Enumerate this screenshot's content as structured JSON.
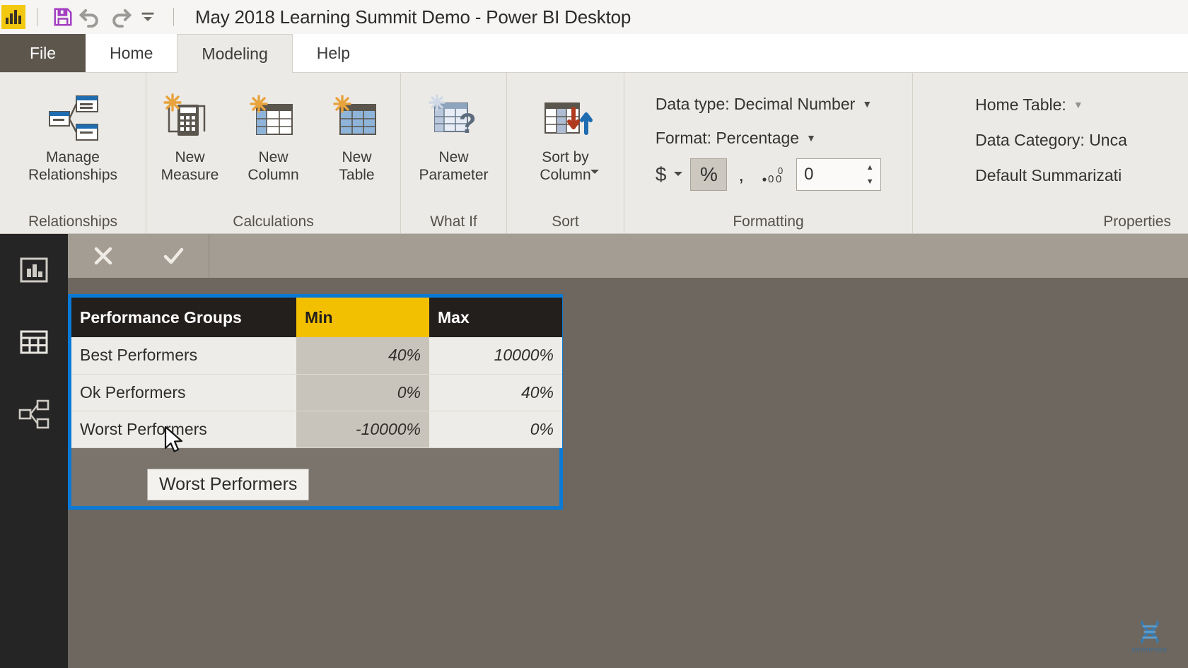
{
  "titlebar": {
    "logo_icon": "power-bi-logo",
    "save_icon": "save-icon",
    "undo_icon": "undo-icon",
    "redo_icon": "redo-icon",
    "customize_icon": "chevron-down-icon",
    "title": "May 2018 Learning Summit Demo - Power BI Desktop"
  },
  "tabs": [
    {
      "label": "File",
      "active": false
    },
    {
      "label": "Home",
      "active": false
    },
    {
      "label": "Modeling",
      "active": true
    },
    {
      "label": "Help",
      "active": false
    }
  ],
  "ribbon": {
    "groups": [
      {
        "label": "Relationships",
        "buttons": [
          {
            "label": "Manage\nRelationships",
            "icon": "manage-relationships-icon"
          }
        ]
      },
      {
        "label": "Calculations",
        "buttons": [
          {
            "label": "New\nMeasure",
            "icon": "new-measure-icon"
          },
          {
            "label": "New\nColumn",
            "icon": "new-column-icon"
          },
          {
            "label": "New\nTable",
            "icon": "new-table-icon"
          }
        ]
      },
      {
        "label": "What If",
        "buttons": [
          {
            "label": "New\nParameter",
            "icon": "new-parameter-icon"
          }
        ]
      },
      {
        "label": "Sort",
        "buttons": [
          {
            "label": "Sort by\nColumn",
            "icon": "sort-by-column-icon"
          }
        ]
      }
    ],
    "formatting": {
      "label": "Formatting",
      "data_type_label": "Data type: Decimal Number",
      "format_label": "Format: Percentage",
      "currency_symbol": "$",
      "percent_symbol": "%",
      "thousands_symbol": ",",
      "decimal_icon": "decimal-places-icon",
      "decimal_places": "0"
    },
    "properties": {
      "label": "Properties",
      "home_table_label": "Home Table:",
      "data_category_label": "Data Category: Unca",
      "default_summarization_label": "Default Summarizati"
    }
  },
  "leftnav": {
    "items": [
      {
        "icon": "report-view-icon",
        "name": "report-view"
      },
      {
        "icon": "data-view-icon",
        "name": "data-view"
      },
      {
        "icon": "model-view-icon",
        "name": "model-view"
      }
    ]
  },
  "formula_bar": {
    "cancel_icon": "close-icon",
    "confirm_icon": "check-icon",
    "value": ""
  },
  "table": {
    "columns": [
      {
        "header": "Performance Groups",
        "selected": false,
        "align": "left"
      },
      {
        "header": "Min",
        "selected": true,
        "align": "right"
      },
      {
        "header": "Max",
        "selected": false,
        "align": "right"
      }
    ],
    "rows": [
      {
        "name": "Best Performers",
        "min": "40%",
        "max": "10000%"
      },
      {
        "name": "Ok Performers",
        "min": "0%",
        "max": "40%"
      },
      {
        "name": "Worst Performers",
        "min": "-10000%",
        "max": "0%"
      }
    ]
  },
  "tooltip": {
    "text": "Worst Performers"
  },
  "watermark": {
    "label": "ENTERPRISE",
    "icon": "dna-helix-icon"
  },
  "colors": {
    "accent_yellow": "#f2c000",
    "selection_blue": "#0b7ad6",
    "header_dark": "#231f1d",
    "ribbon_bg": "#eceae6",
    "canvas_bg": "#6d675f"
  }
}
